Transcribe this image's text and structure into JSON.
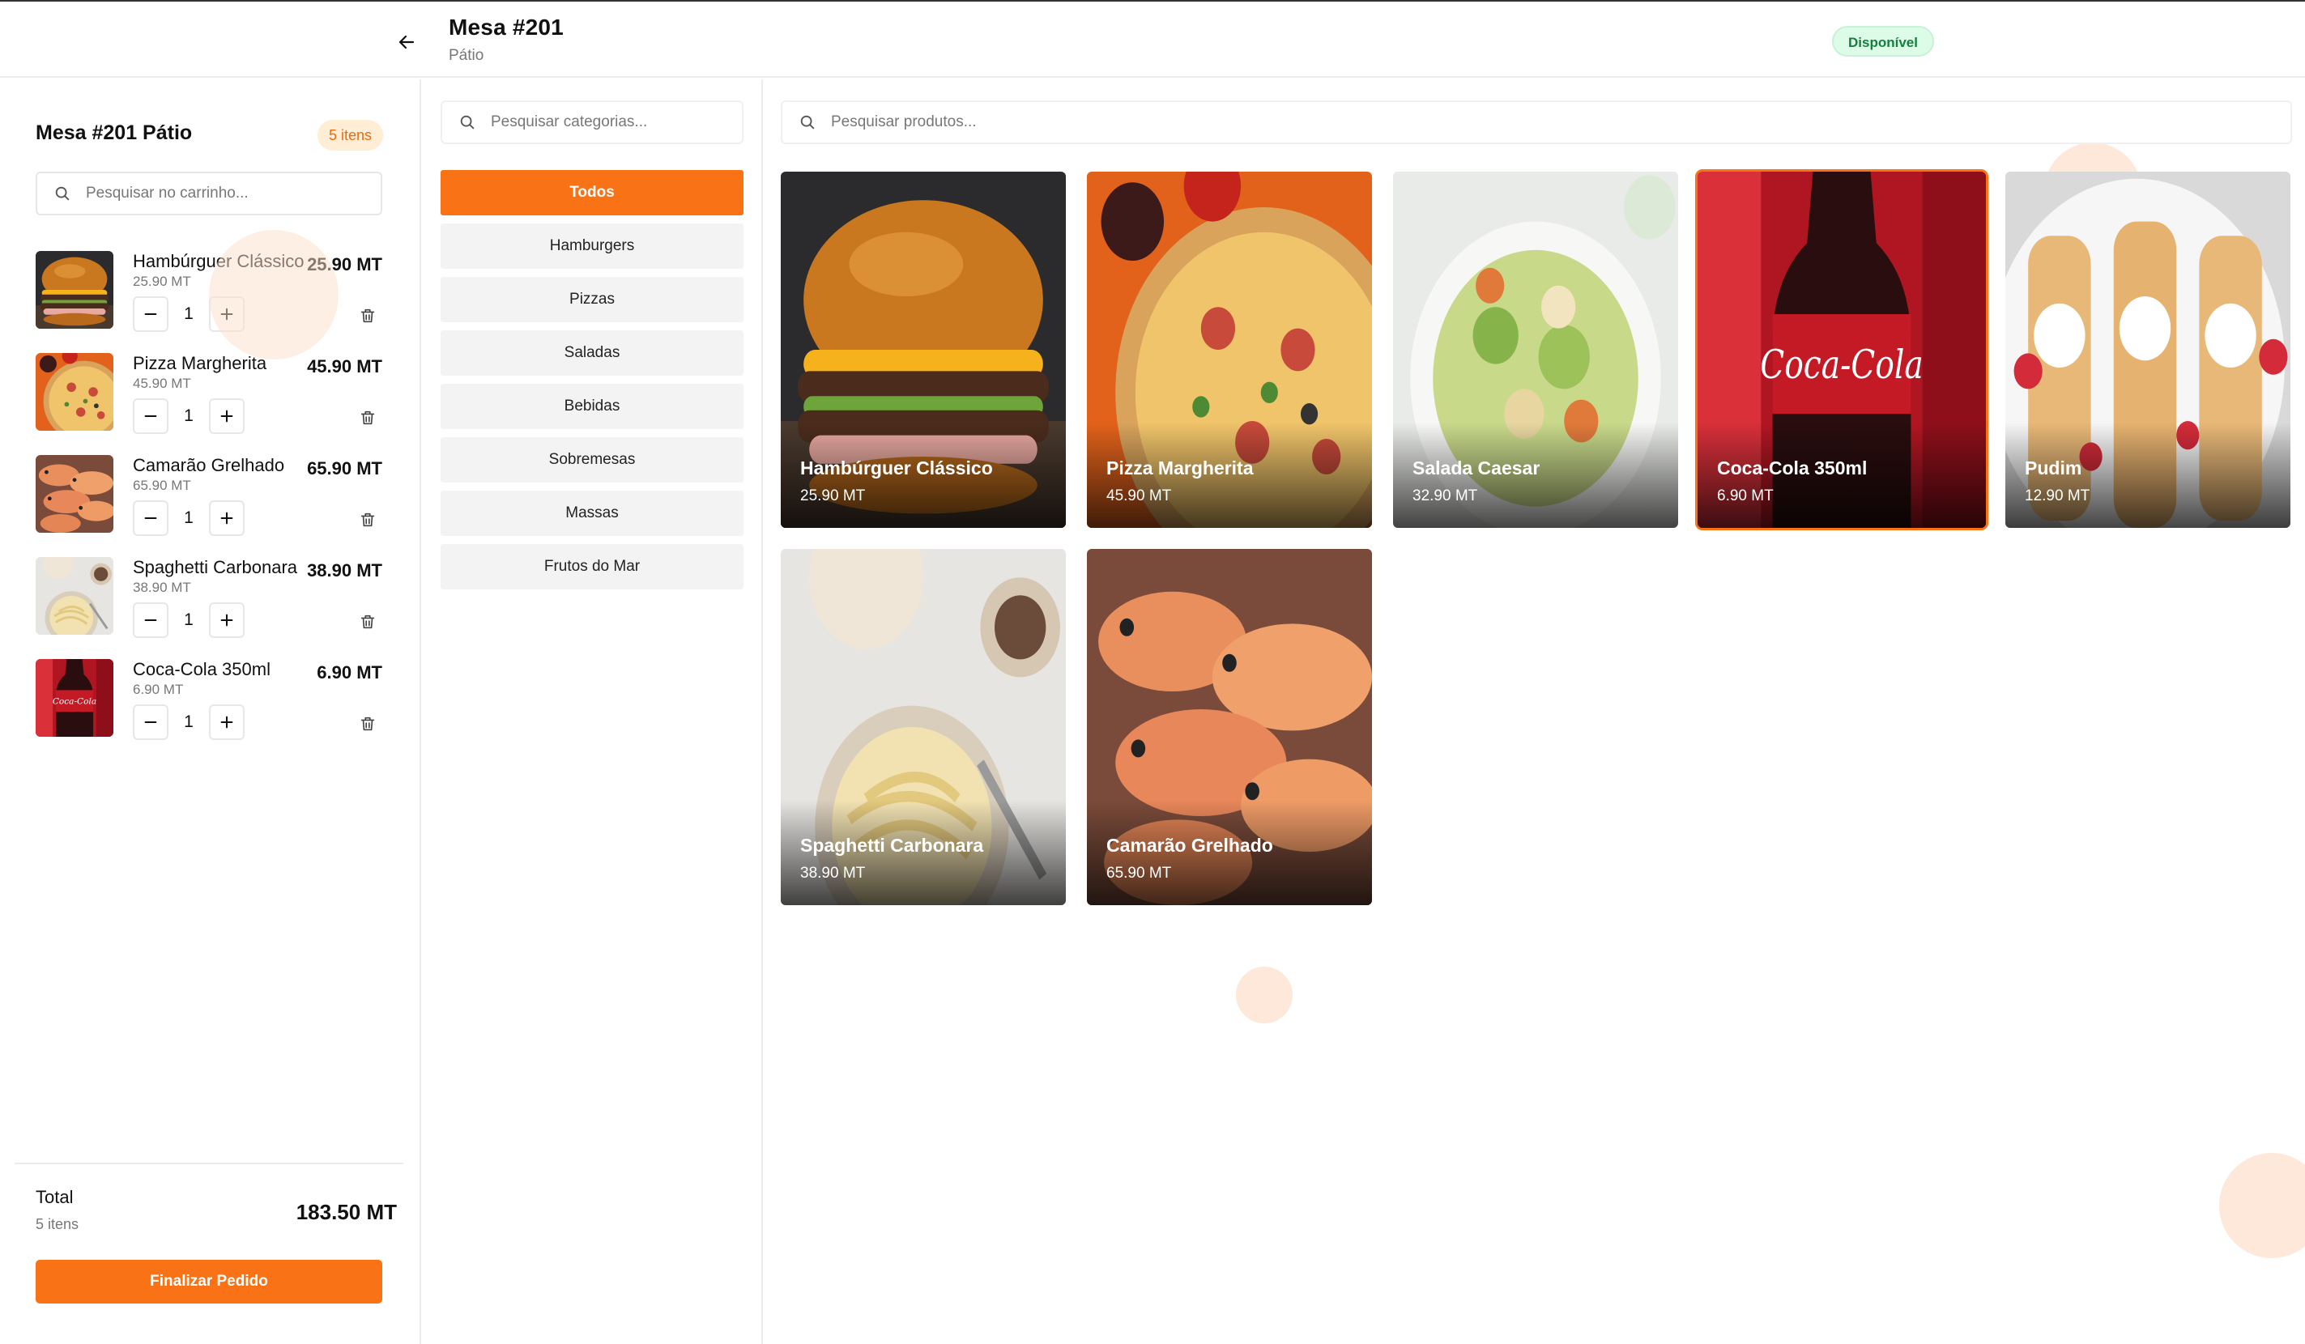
{
  "header": {
    "title": "Mesa #201",
    "subtitle": "Pátio",
    "status": "Disponível"
  },
  "cart": {
    "title": "Mesa #201 Pátio",
    "count_badge": "5 itens",
    "search_placeholder": "Pesquisar no carrinho...",
    "items": [
      {
        "name": "Hambúrguer Clássico",
        "unit_price": "25.90 MT",
        "quantity": "1",
        "total": "25.90 MT",
        "image": "burger"
      },
      {
        "name": "Pizza Margherita",
        "unit_price": "45.90 MT",
        "quantity": "1",
        "total": "45.90 MT",
        "image": "pizza"
      },
      {
        "name": "Camarão Grelhado",
        "unit_price": "65.90 MT",
        "quantity": "1",
        "total": "65.90 MT",
        "image": "shrimp"
      },
      {
        "name": "Spaghetti Carbonara",
        "unit_price": "38.90 MT",
        "quantity": "1",
        "total": "38.90 MT",
        "image": "pasta"
      },
      {
        "name": "Coca-Cola 350ml",
        "unit_price": "6.90 MT",
        "quantity": "1",
        "total": "6.90 MT",
        "image": "cola"
      }
    ],
    "total_label": "Total",
    "total_count": "5 itens",
    "total_value": "183.50 MT",
    "finalize_label": "Finalizar Pedido"
  },
  "categories": {
    "search_placeholder": "Pesquisar categorias...",
    "items": [
      "Todos",
      "Hamburgers",
      "Pizzas",
      "Saladas",
      "Bebidas",
      "Sobremesas",
      "Massas",
      "Frutos do Mar"
    ],
    "active": "Todos"
  },
  "products": {
    "search_placeholder": "Pesquisar produtos...",
    "items": [
      {
        "name": "Hambúrguer Clássico",
        "price": "25.90 MT",
        "image": "burger"
      },
      {
        "name": "Pizza Margherita",
        "price": "45.90 MT",
        "image": "pizza"
      },
      {
        "name": "Salada Caesar",
        "price": "32.90 MT",
        "image": "salad"
      },
      {
        "name": "Coca-Cola 350ml",
        "price": "6.90 MT",
        "image": "cola",
        "selected": true
      },
      {
        "name": "Pudim",
        "price": "12.90 MT",
        "image": "dessert"
      },
      {
        "name": "Spaghetti Carbonara",
        "price": "38.90 MT",
        "image": "pasta"
      },
      {
        "name": "Camarão Grelhado",
        "price": "65.90 MT",
        "image": "shrimp"
      }
    ]
  },
  "icons": {
    "back": "arrow-left-icon",
    "search": "search-icon",
    "minus": "minus-icon",
    "plus": "plus-icon",
    "trash": "trash-icon"
  },
  "colors": {
    "accent": "#f97316",
    "status_bg": "#dcfce7",
    "status_text": "#15803d",
    "badge_bg": "#ffedd5",
    "badge_text": "#ea6b0d"
  }
}
